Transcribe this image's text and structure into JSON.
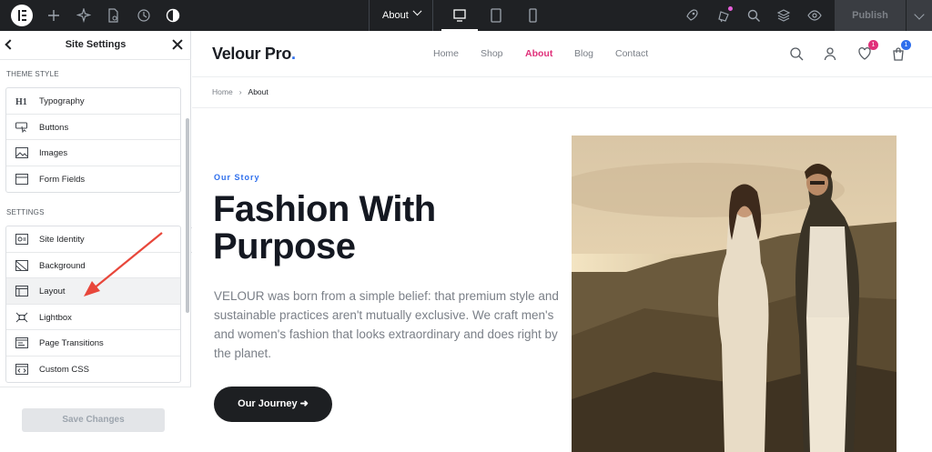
{
  "editor": {
    "page_selector": "About",
    "publish_label": "Publish"
  },
  "panel": {
    "title": "Site Settings",
    "theme_style_label": "THEME STYLE",
    "theme_items": [
      {
        "label": "Typography",
        "icon": "typography-h1-icon"
      },
      {
        "label": "Buttons",
        "icon": "button-cursor-icon"
      },
      {
        "label": "Images",
        "icon": "image-icon"
      },
      {
        "label": "Form Fields",
        "icon": "form-fields-icon"
      }
    ],
    "settings_label": "SETTINGS",
    "settings_items": [
      {
        "label": "Site Identity",
        "icon": "site-identity-icon"
      },
      {
        "label": "Background",
        "icon": "background-icon"
      },
      {
        "label": "Layout",
        "icon": "layout-icon"
      },
      {
        "label": "Lightbox",
        "icon": "lightbox-icon"
      },
      {
        "label": "Page Transitions",
        "icon": "page-transitions-icon"
      },
      {
        "label": "Custom CSS",
        "icon": "custom-css-icon"
      }
    ],
    "save_label": "Save Changes"
  },
  "site": {
    "brand": "Velour Pro",
    "brand_dot": ".",
    "nav": [
      "Home",
      "Shop",
      "About",
      "Blog",
      "Contact"
    ],
    "active_nav": "About",
    "wishlist_count": "1",
    "cart_count": "1",
    "breadcrumb": {
      "home": "Home",
      "separator": "›",
      "current": "About"
    },
    "eyebrow": "Our Story",
    "headline": "Fashion With Purpose",
    "body": "VELOUR was born from a simple belief: that premium style and sustainable practices aren't mutually exclusive. We craft men's and women's fashion that looks extraordinary and does right by the planet.",
    "cta_label": "Our Journey ➜"
  },
  "colors": {
    "editor_bar": "#1f2124",
    "accent_pink": "#e0317a",
    "accent_blue": "#2f6fec",
    "annotation_arrow": "#e8473b"
  }
}
